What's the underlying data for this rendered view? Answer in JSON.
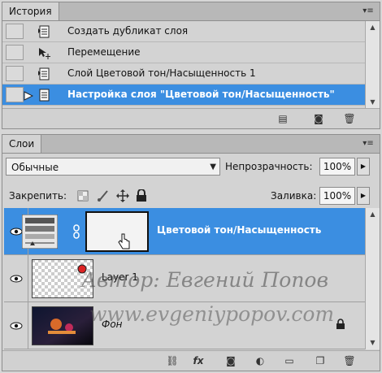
{
  "history": {
    "tab": "История",
    "menu_icon": "▾≡",
    "items": [
      {
        "label": "Создать дубликат слоя",
        "icon": "document-icon"
      },
      {
        "label": "Перемещение",
        "icon": "move-icon"
      },
      {
        "label": "Слой Цветовой тон/Насыщенность 1",
        "icon": "document-icon"
      },
      {
        "label": "Настройка слоя \"Цветовой тон/Насыщенность\"",
        "icon": "document-icon",
        "selected": true
      }
    ]
  },
  "layers": {
    "tab": "Слои",
    "menu_icon": "▾≡",
    "blend_mode": "Обычные",
    "opacity_label": "Непрозрачность:",
    "opacity_value": "100%",
    "lock_label": "Закрепить:",
    "fill_label": "Заливка:",
    "fill_value": "100%",
    "items": [
      {
        "name": "Цветовой тон/Насыщенность",
        "selected": true
      },
      {
        "name": "Layer 1"
      },
      {
        "name": "Фон",
        "locked": true
      }
    ]
  },
  "watermark": {
    "line1": "Автор: Евгений Попов",
    "line2": "www.evgeniypopov.com"
  },
  "colors": {
    "selection": "#3b8ee1",
    "panel": "#d3d3d3"
  }
}
